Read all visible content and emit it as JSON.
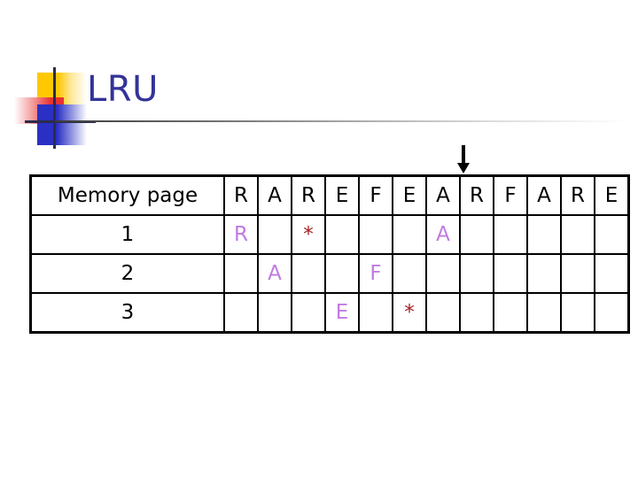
{
  "slide": {
    "title": "LRU",
    "title_color": "#333399",
    "background_color": "#ffffff",
    "letter_color": "#C07BE0",
    "star_color": "#A52021",
    "border_color": "#000000"
  },
  "logo": {
    "yellow": "#FFC800",
    "red": "#E83131",
    "blue": "#2B30C4",
    "line": "#2B2B4E"
  },
  "arrow": {
    "direction": "down",
    "points_to_column_index": 8,
    "points_to_column_label": "R",
    "color": "#000000"
  },
  "table": {
    "header_label": "Memory page",
    "reference_string": [
      "R",
      "A",
      "R",
      "E",
      "F",
      "E",
      "A",
      "R",
      "F",
      "A",
      "R",
      "E"
    ],
    "row_labels": [
      "1",
      "2",
      "3"
    ],
    "rows": [
      {
        "label": "1",
        "cells": [
          {
            "text": "R",
            "kind": "letter"
          },
          {
            "text": "",
            "kind": "empty"
          },
          {
            "text": "*",
            "kind": "star"
          },
          {
            "text": "",
            "kind": "empty"
          },
          {
            "text": "",
            "kind": "empty"
          },
          {
            "text": "",
            "kind": "empty"
          },
          {
            "text": "A",
            "kind": "letter"
          },
          {
            "text": "",
            "kind": "empty"
          },
          {
            "text": "",
            "kind": "empty"
          },
          {
            "text": "",
            "kind": "empty"
          },
          {
            "text": "",
            "kind": "empty"
          },
          {
            "text": "",
            "kind": "empty"
          }
        ]
      },
      {
        "label": "2",
        "cells": [
          {
            "text": "",
            "kind": "empty"
          },
          {
            "text": "A",
            "kind": "letter"
          },
          {
            "text": "",
            "kind": "empty"
          },
          {
            "text": "",
            "kind": "empty"
          },
          {
            "text": "F",
            "kind": "letter"
          },
          {
            "text": "",
            "kind": "empty"
          },
          {
            "text": "",
            "kind": "empty"
          },
          {
            "text": "",
            "kind": "empty"
          },
          {
            "text": "",
            "kind": "empty"
          },
          {
            "text": "",
            "kind": "empty"
          },
          {
            "text": "",
            "kind": "empty"
          },
          {
            "text": "",
            "kind": "empty"
          }
        ]
      },
      {
        "label": "3",
        "cells": [
          {
            "text": "",
            "kind": "empty"
          },
          {
            "text": "",
            "kind": "empty"
          },
          {
            "text": "",
            "kind": "empty"
          },
          {
            "text": "E",
            "kind": "letter"
          },
          {
            "text": "",
            "kind": "empty"
          },
          {
            "text": "*",
            "kind": "star"
          },
          {
            "text": "",
            "kind": "empty"
          },
          {
            "text": "",
            "kind": "empty"
          },
          {
            "text": "",
            "kind": "empty"
          },
          {
            "text": "",
            "kind": "empty"
          },
          {
            "text": "",
            "kind": "empty"
          },
          {
            "text": "",
            "kind": "empty"
          }
        ]
      }
    ]
  }
}
